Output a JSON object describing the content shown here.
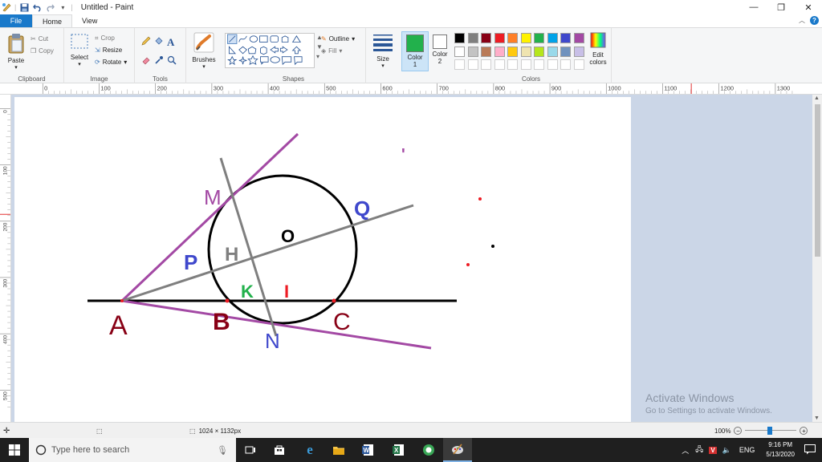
{
  "window": {
    "title": "Untitled - Paint"
  },
  "tabs": {
    "file": "File",
    "home": "Home",
    "view": "View"
  },
  "ribbon": {
    "clipboard": {
      "label": "Clipboard",
      "paste": "Paste",
      "cut": "Cut",
      "copy": "Copy"
    },
    "image": {
      "label": "Image",
      "select": "Select",
      "crop": "Crop",
      "resize": "Resize",
      "rotate": "Rotate"
    },
    "tools": {
      "label": "Tools"
    },
    "brushes": {
      "label": "Brushes"
    },
    "shapes": {
      "label": "Shapes",
      "outline": "Outline",
      "fill": "Fill"
    },
    "size": {
      "label": "Size"
    },
    "color1": {
      "label": "Color",
      "num": "1"
    },
    "color2": {
      "label": "Color",
      "num": "2"
    },
    "colors": {
      "label": "Colors",
      "edit": "Edit",
      "edit2": "colors"
    },
    "palette_row1": [
      "#000000",
      "#7f7f7f",
      "#880015",
      "#ed1c24",
      "#ff7f27",
      "#fff200",
      "#22b14c",
      "#00a2e8",
      "#3f48cc",
      "#a349a4"
    ],
    "palette_row2": [
      "#ffffff",
      "#c3c3c3",
      "#b97a57",
      "#ffaec9",
      "#ffc90e",
      "#efe4b0",
      "#b5e61d",
      "#99d9ea",
      "#7092be",
      "#c8bfe7"
    ],
    "color1_value": "#22b14c",
    "color2_value": "#ffffff"
  },
  "ruler": {
    "h_ticks": [
      "0",
      "100",
      "200",
      "300",
      "400",
      "500",
      "600",
      "700",
      "800",
      "900",
      "1000",
      "1100",
      "1200",
      "1300"
    ],
    "v_ticks": [
      "0",
      "100",
      "200",
      "300",
      "400",
      "500"
    ]
  },
  "drawing": {
    "labels": {
      "M": "M",
      "Q": "Q",
      "O": "O",
      "H": "H",
      "P": "P",
      "K": "K",
      "I": "I",
      "A": "A",
      "B": "B",
      "C": "C",
      "N": "N",
      "tick": "'"
    },
    "colors": {
      "purple": "#a349a4",
      "gray": "#7f7f7f",
      "blue": "#3f48cc",
      "green": "#22b14c",
      "red": "#ed1c24",
      "darkred": "#880015",
      "black": "#000000"
    }
  },
  "watermark": {
    "line1": "Activate Windows",
    "line2": "Go to Settings to activate Windows."
  },
  "status": {
    "dimensions": "1024 × 1132px",
    "zoom": "100%"
  },
  "taskbar": {
    "search_placeholder": "Type here to search",
    "lang": "ENG",
    "time": "9:16 PM",
    "date": "5/13/2020"
  }
}
